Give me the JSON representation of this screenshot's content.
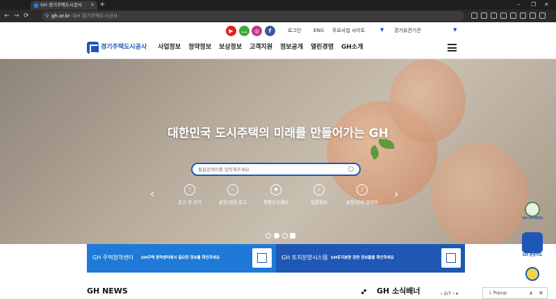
{
  "browser": {
    "tab_title": "GH 경기주택도시공사",
    "tab_close": "×",
    "new_tab": "+",
    "nav": {
      "back": "←",
      "forward": "→",
      "reload": "⟳"
    },
    "secure_icon": "⚲",
    "url_domain": "gh.or.kr",
    "url_title": "GH 경기주택도시공사",
    "window": {
      "min": "–",
      "restore": "❐",
      "close": "✕"
    }
  },
  "header": {
    "social": [
      {
        "name": "youtube",
        "glyph": "▶",
        "color": "#e62117"
      },
      {
        "name": "kakao",
        "glyph": "…",
        "color": "#3fa93c"
      },
      {
        "name": "instagram",
        "glyph": "◎",
        "color": "#c13584"
      },
      {
        "name": "facebook",
        "glyph": "f",
        "color": "#3b5998"
      }
    ],
    "login": "로그인",
    "lang": "ENG",
    "major_sites": "주요사업 사이트",
    "related_orgs": "경기유관기관",
    "logo_text": "경기주택도시공사",
    "gnb": [
      "사업정보",
      "청약정보",
      "보상정보",
      "고객지원",
      "정보공개",
      "열린경영",
      "GH소개"
    ]
  },
  "hero": {
    "title": "대한민국 도시주택의 미래를 만들어가는 GH",
    "search_placeholder": "통합검색어를 입력해주세요",
    "quick_links": [
      {
        "label": "공고 및 공지",
        "glyph": "!"
      },
      {
        "label": "분양/임대 공고",
        "glyph": "~"
      },
      {
        "label": "청렴신고센터",
        "glyph": "✹"
      },
      {
        "label": "입찰정보",
        "glyph": "⌕"
      },
      {
        "label": "분양/임대 알리미",
        "glyph": "♪"
      }
    ],
    "prev": "‹",
    "next": "›"
  },
  "banners": [
    {
      "title": "GH 주택청약센터",
      "desc": "GH주택 청약센터에서 필요한 정보를 확인하세요",
      "color": "#1e7ad6"
    },
    {
      "title": "GH 토지분양시스템",
      "desc": "GH토지분양 관련 정보들을 확인하세요",
      "color": "#1f57b5"
    }
  ],
  "news": {
    "title": "GH NEWS"
  },
  "banner_section": {
    "title": "GH 소식배너",
    "pager": "‹ 2/7 › ⏸"
  },
  "floating": [
    {
      "label": "GH 아이캐릭터"
    },
    {
      "label": "GH 분양지도"
    },
    {
      "label": ""
    }
  ],
  "popup": {
    "count": "1",
    "label": "Popup",
    "up": "∧",
    "close": "✕"
  }
}
